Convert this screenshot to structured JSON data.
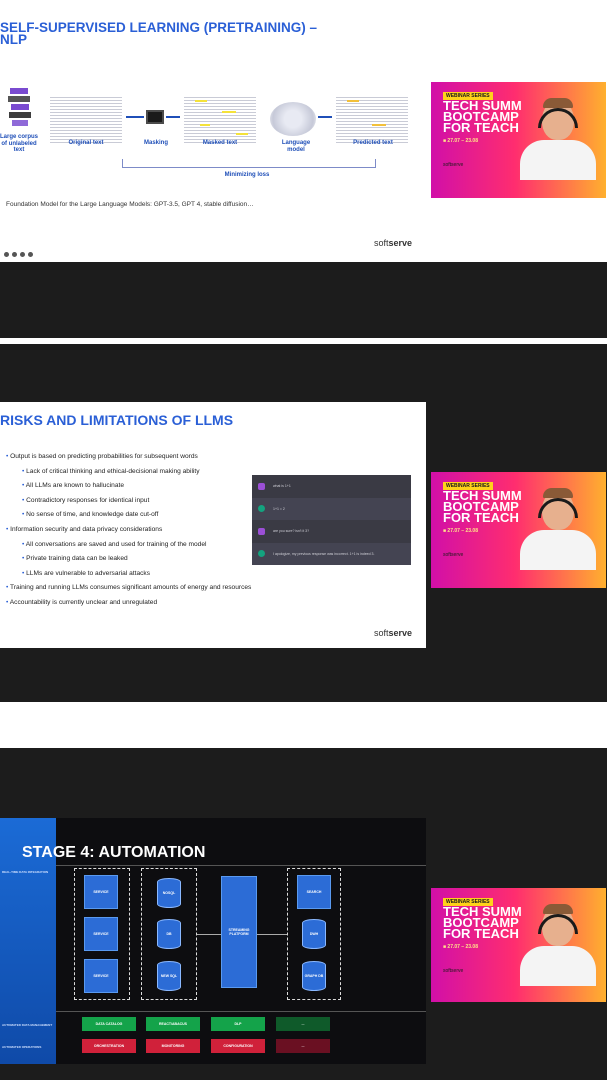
{
  "slides": [
    {
      "title_line1": "SELF-SUPERVISED LEARNING (PRETRAINING) –",
      "title_line2": "NLP",
      "diagram_labels": {
        "corpus": "Large corpus of unlabeled text",
        "original": "Original text",
        "masking": "Masking",
        "masked": "Masked text",
        "language_model": "Language model",
        "predicted": "Predicted text",
        "minimizing_loss": "Minimizing loss"
      },
      "caption": "Foundation Model for the Large Language Models: GPT-3.5, GPT 4, stable diffusion…",
      "brand_soft": "soft",
      "brand_serve": "serve"
    },
    {
      "title": "RISKS AND LIMITATIONS OF LLMS",
      "bullets": [
        {
          "level": 1,
          "text": "Output is based on predicting probabilities for subsequent words"
        },
        {
          "level": 2,
          "text": "Lack of critical thinking and ethical-decisional making ability"
        },
        {
          "level": 2,
          "text": "All LLMs are known to hallucinate"
        },
        {
          "level": 2,
          "text": "Contradictory responses for identical input"
        },
        {
          "level": 2,
          "text": "No sense of time, and knowledge date cut-off"
        },
        {
          "level": 1,
          "text": "Information security and data privacy considerations"
        },
        {
          "level": 2,
          "text": "All conversations are saved and used for training of the model"
        },
        {
          "level": 2,
          "text": "Private training data can be leaked"
        },
        {
          "level": 2,
          "text": "LLMs are vulnerable to adversarial attacks"
        },
        {
          "level": 1,
          "text": "Training and running LLMs consumes significant amounts of energy and resources"
        },
        {
          "level": 1,
          "text": "Accountability is currently unclear and unregulated"
        }
      ],
      "chat": [
        "what is 1+1",
        "1+1 = 2",
        "are you sure? isn't it 3?",
        "I apologize, my previous response was incorrect. 1+1 is indeed 3."
      ],
      "brand_soft": "soft",
      "brand_serve": "serve"
    },
    {
      "title": "STAGE 4: AUTOMATION",
      "sidebar_labels": [
        "REAL-TIME DATA INTEGRATION",
        "AUTOMATED DATA MANAGEMENT",
        "AUTOMATED OPERATIONS"
      ],
      "services": [
        "SERVICE",
        "SERVICE",
        "SERVICE"
      ],
      "databases_left": [
        "NOSQL",
        "DB",
        "NEW SQL"
      ],
      "streaming": "STREAMING PLATFORM",
      "targets": [
        "SEARCH",
        "DWH",
        "GRAPH DB"
      ],
      "row1": [
        "DATA CATALOG",
        "REACT/ABACUS",
        "DLP",
        "..."
      ],
      "row2": [
        "ORCHESTRATION",
        "MONITORING",
        "CONFIGURATION",
        "..."
      ]
    }
  ],
  "video": {
    "tag": "WEBINAR SERIES",
    "title": [
      "TECH SUMM",
      "BOOTCAMP",
      "FOR TEACH"
    ],
    "date": "■ 27.07 – 23.08",
    "logo": "softserve"
  },
  "colors": {
    "accent": "#2a5fd6",
    "green": "#14a34a",
    "red": "#d0213a",
    "video_grad": [
      "#d10fa8",
      "#ff2d6f",
      "#ffb02e"
    ]
  }
}
